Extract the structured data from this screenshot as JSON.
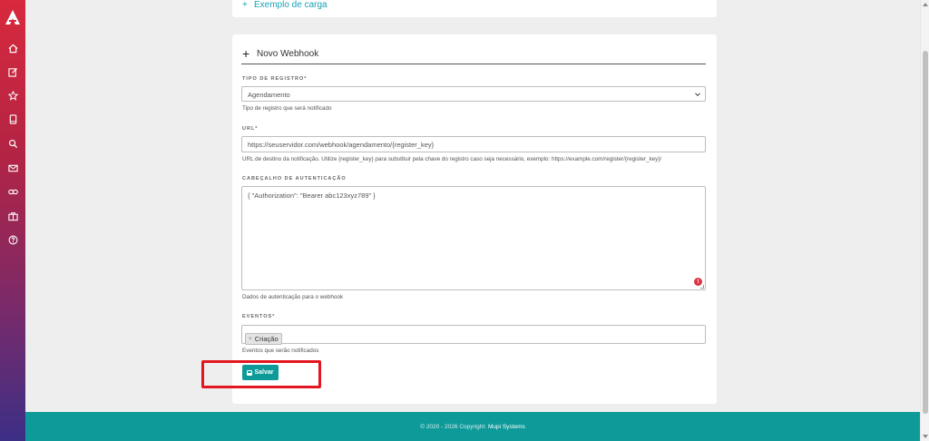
{
  "sidebar": {
    "icons": [
      "logo-icon",
      "home-icon",
      "edit-icon",
      "star-icon",
      "book-icon",
      "search-icon",
      "mail-icon",
      "link-icon",
      "briefcase-icon",
      "help-icon"
    ]
  },
  "top_card": {
    "link_label": "Exemplo de carga"
  },
  "webhook_form": {
    "title": "Novo Webhook",
    "tipo_registro": {
      "label": "TIPO DE REGISTRO*",
      "value": "Agendamento",
      "help": "Tipo de registro que será notificado"
    },
    "url": {
      "label": "URL*",
      "value": "https://seuservidor.com/webhook/agendamento/{register_key}",
      "help": "URL de destino da notificação. Utilize {register_key} para substituir pela chave do registro caso seja necessário, exemplo: https://example.com/register/{register_key}/"
    },
    "cabecalho": {
      "label": "CABEÇALHO DE AUTENTICAÇÃO",
      "value": "{ \"Authorization\": \"Bearer abc123xyz789\" }",
      "help": "Dados de autenticação para o webhook"
    },
    "eventos": {
      "label": "EVENTOS*",
      "tags": [
        "Criação"
      ],
      "help": "Eventos que serão notificados"
    },
    "save_label": "Salvar"
  },
  "footer": {
    "copyright": "© 2020 - 2026 Copyright:",
    "brand": "Mupi Systems"
  },
  "colors": {
    "accent": "#0f9a9a",
    "highlight": "#e3151f",
    "error": "#dc3545"
  }
}
